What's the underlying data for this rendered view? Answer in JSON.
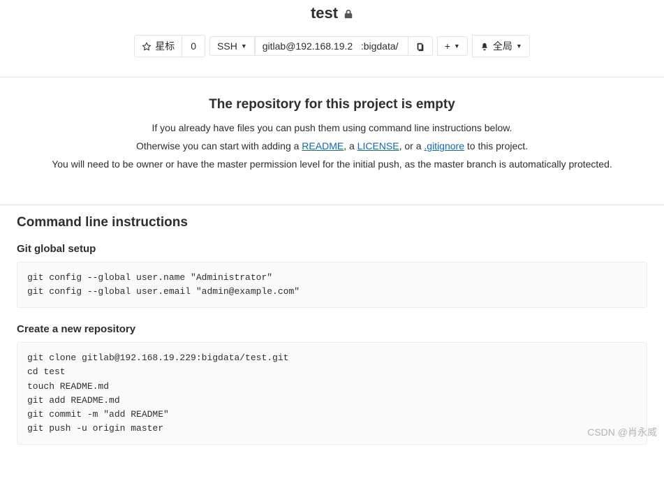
{
  "header": {
    "title": "test"
  },
  "toolbar": {
    "star_label": "星标",
    "star_count": "0",
    "protocol_label": "SSH",
    "clone_url": "gitlab@192.168.19.2   :bigdata/",
    "add_label": "+",
    "notify_label": "全局"
  },
  "empty": {
    "title": "The repository for this project is empty",
    "line1": "If you already have files you can push them using command line instructions below.",
    "line2_pre": "Otherwise you can start with adding a ",
    "readme": "README",
    "sep_a": ", a ",
    "license": "LICENSE",
    "sep_or": ", or a ",
    "gitignore": ".gitignore",
    "line2_post": " to this project.",
    "line3": "You will need to be owner or have the master permission level for the initial push, as the master branch is automatically protected."
  },
  "cli": {
    "heading": "Command line instructions",
    "global_title": "Git global setup",
    "global_code": "git config --global user.name \"Administrator\"\ngit config --global user.email \"admin@example.com\"",
    "create_title": "Create a new repository",
    "create_code": "git clone gitlab@192.168.19.229:bigdata/test.git\ncd test\ntouch README.md\ngit add README.md\ngit commit -m \"add README\"\ngit push -u origin master"
  },
  "watermark": "CSDN @肖永威"
}
